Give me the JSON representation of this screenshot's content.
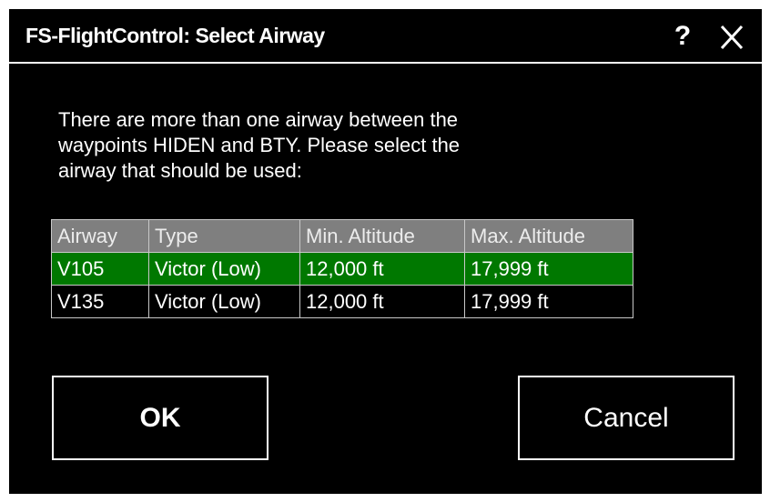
{
  "dialog": {
    "title": "FS-FlightControl: Select Airway",
    "help_label": "?",
    "close_icon": "close-icon",
    "message": "There are more than one airway between the\nwaypoints HIDEN and BTY. Please select the\nairway that should be used:"
  },
  "table": {
    "headers": [
      "Airway",
      "Type",
      "Min. Altitude",
      "Max. Altitude"
    ],
    "rows": [
      {
        "airway": "V105",
        "type": "Victor (Low)",
        "min_altitude": "12,000 ft",
        "max_altitude": "17,999 ft",
        "selected": true
      },
      {
        "airway": "V135",
        "type": "Victor (Low)",
        "min_altitude": "12,000 ft",
        "max_altitude": "17,999 ft",
        "selected": false
      }
    ],
    "header_bg": "#7f7f7f",
    "selected_bg": "#007800"
  },
  "buttons": {
    "ok_label": "OK",
    "cancel_label": "Cancel"
  }
}
